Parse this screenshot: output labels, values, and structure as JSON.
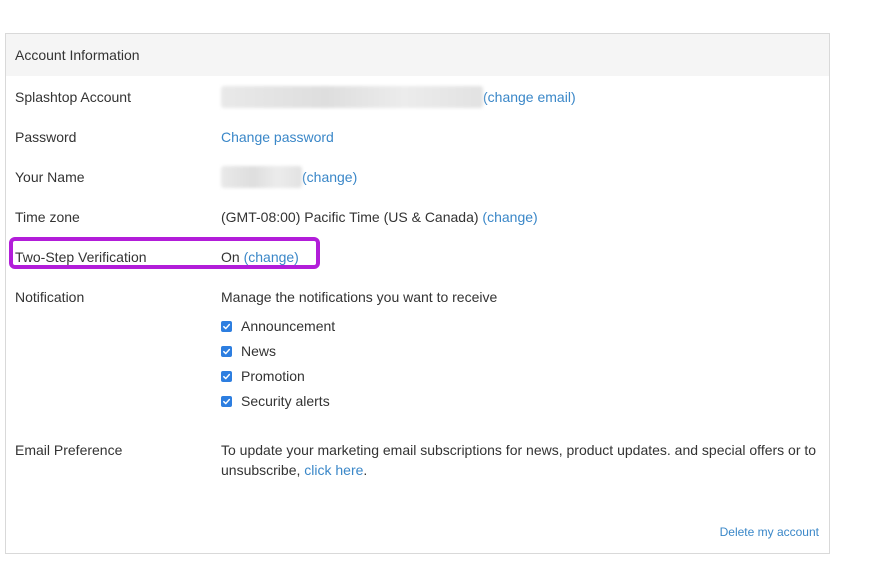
{
  "header": {
    "title": "Account Information"
  },
  "rows": {
    "account": {
      "label": "Splashtop Account",
      "action": "(change email)"
    },
    "password": {
      "label": "Password",
      "action": "Change password"
    },
    "name": {
      "label": "Your Name",
      "action": "(change)"
    },
    "timezone": {
      "label": "Time zone",
      "value": "(GMT-08:00) Pacific Time (US & Canada)",
      "action": "(change)"
    },
    "two_step": {
      "label": "Two-Step Verification",
      "value": "On",
      "action": "(change)"
    },
    "notification": {
      "label": "Notification",
      "description": "Manage the notifications you want to receive",
      "options": [
        {
          "label": "Announcement",
          "checked": true
        },
        {
          "label": "News",
          "checked": true
        },
        {
          "label": "Promotion",
          "checked": true
        },
        {
          "label": "Security alerts",
          "checked": true
        }
      ]
    },
    "email_preference": {
      "label": "Email Preference",
      "text_before": "To update your marketing email subscriptions for news, product updates. and special offers or to unsubscribe,",
      "link": "click here",
      "text_after": "."
    }
  },
  "footer": {
    "delete_label": "Delete my account"
  },
  "colors": {
    "link": "#3a87c8",
    "checkbox": "#2d7ee0",
    "highlight": "#b21dd9",
    "header_bg": "#f5f5f5"
  }
}
